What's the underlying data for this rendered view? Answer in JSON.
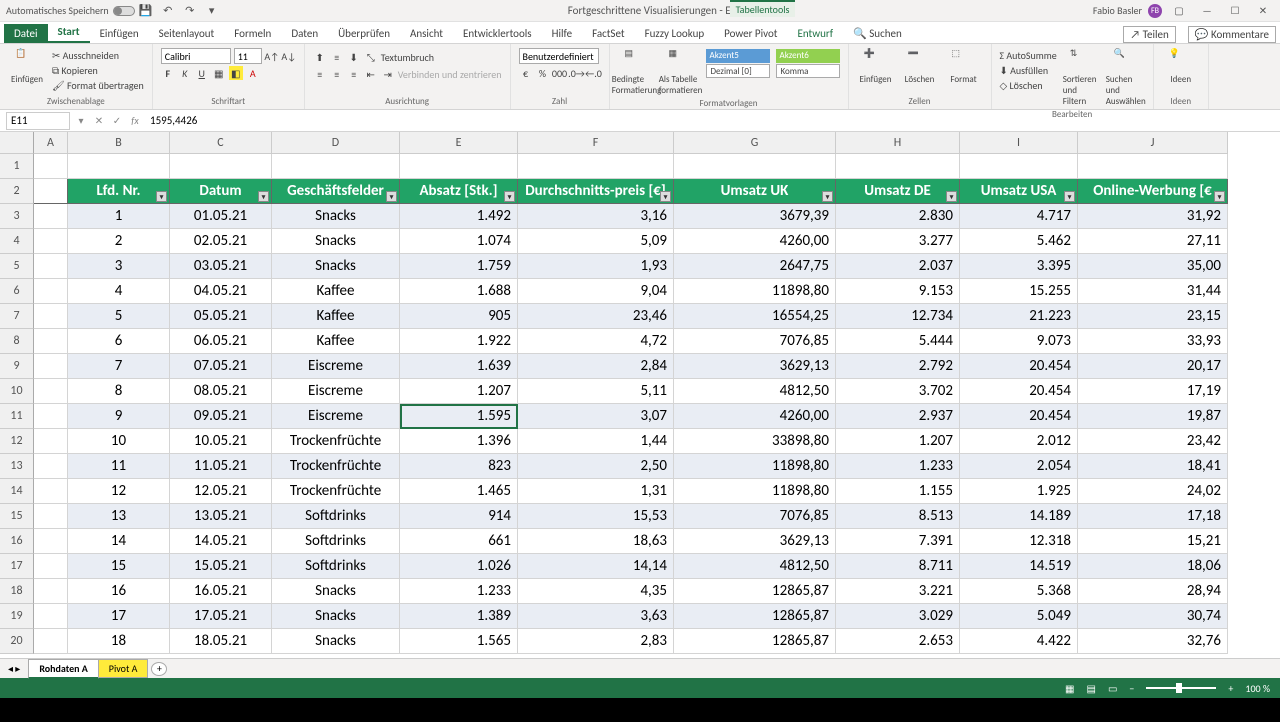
{
  "title": {
    "autosave": "Automatisches Speichern",
    "doc": "Fortgeschrittene Visualisierungen  -  Excel",
    "tabletools": "Tabellentools",
    "user": "Fabio Basler"
  },
  "tabs": {
    "file": "Datei",
    "home": "Start",
    "insert": "Einfügen",
    "layout": "Seitenlayout",
    "formulas": "Formeln",
    "data": "Daten",
    "review": "Überprüfen",
    "view": "Ansicht",
    "dev": "Entwicklertools",
    "help": "Hilfe",
    "factset": "FactSet",
    "fuzzy": "Fuzzy Lookup",
    "pivot": "Power Pivot",
    "design": "Entwurf",
    "search": "Suchen",
    "share": "Teilen",
    "comments": "Kommentare"
  },
  "ribbon": {
    "paste": "Einfügen",
    "cut": "Ausschneiden",
    "copy": "Kopieren",
    "fmtpaint": "Format übertragen",
    "clipboard": "Zwischenablage",
    "font": "Calibri",
    "size": "11",
    "fontgrp": "Schriftart",
    "wrap": "Textumbruch",
    "merge": "Verbinden und zentrieren",
    "align": "Ausrichtung",
    "numfmt": "Benutzerdefiniert",
    "numgrp": "Zahl",
    "condfmt": "Bedingte Formatierung",
    "astable": "Als Tabelle formatieren",
    "ak5": "Akzent5",
    "ak6": "Akzent6",
    "dez": "Dezimal [0]",
    "kom": "Komma",
    "styles": "Formatvorlagen",
    "ins": "Einfügen",
    "del": "Löschen",
    "fmt": "Format",
    "cells": "Zellen",
    "sum": "AutoSumme",
    "fill": "Ausfüllen",
    "clear": "Löschen",
    "sort": "Sortieren und Filtern",
    "find": "Suchen und Auswählen",
    "edit": "Bearbeiten",
    "ideas": "Ideen"
  },
  "fx": {
    "cell": "E11",
    "value": "1595,4426"
  },
  "cols": [
    "A",
    "B",
    "C",
    "D",
    "E",
    "F",
    "G",
    "H",
    "I",
    "J"
  ],
  "headers": [
    "Lfd. Nr.",
    "Datum",
    "Geschäftsfelder",
    "Absatz  [Stk.]",
    "Durchschnitts-preis [€]",
    "Umsatz UK",
    "Umsatz DE",
    "Umsatz USA",
    "Online-Werbung [€"
  ],
  "rows": [
    [
      "1",
      "01.05.21",
      "Snacks",
      "1.492",
      "3,16",
      "3679,39",
      "2.830",
      "4.717",
      "31,92"
    ],
    [
      "2",
      "02.05.21",
      "Snacks",
      "1.074",
      "5,09",
      "4260,00",
      "3.277",
      "5.462",
      "27,11"
    ],
    [
      "3",
      "03.05.21",
      "Snacks",
      "1.759",
      "1,93",
      "2647,75",
      "2.037",
      "3.395",
      "35,00"
    ],
    [
      "4",
      "04.05.21",
      "Kaffee",
      "1.688",
      "9,04",
      "11898,80",
      "9.153",
      "15.255",
      "31,44"
    ],
    [
      "5",
      "05.05.21",
      "Kaffee",
      "905",
      "23,46",
      "16554,25",
      "12.734",
      "21.223",
      "23,15"
    ],
    [
      "6",
      "06.05.21",
      "Kaffee",
      "1.922",
      "4,72",
      "7076,85",
      "5.444",
      "9.073",
      "33,93"
    ],
    [
      "7",
      "07.05.21",
      "Eiscreme",
      "1.639",
      "2,84",
      "3629,13",
      "2.792",
      "20.454",
      "20,17"
    ],
    [
      "8",
      "08.05.21",
      "Eiscreme",
      "1.207",
      "5,11",
      "4812,50",
      "3.702",
      "20.454",
      "17,19"
    ],
    [
      "9",
      "09.05.21",
      "Eiscreme",
      "1.595",
      "3,07",
      "4260,00",
      "2.937",
      "20.454",
      "19,87"
    ],
    [
      "10",
      "10.05.21",
      "Trockenfrüchte",
      "1.396",
      "1,44",
      "33898,80",
      "1.207",
      "2.012",
      "23,42"
    ],
    [
      "11",
      "11.05.21",
      "Trockenfrüchte",
      "823",
      "2,50",
      "11898,80",
      "1.233",
      "2.054",
      "18,41"
    ],
    [
      "12",
      "12.05.21",
      "Trockenfrüchte",
      "1.465",
      "1,31",
      "11898,80",
      "1.155",
      "1.925",
      "24,02"
    ],
    [
      "13",
      "13.05.21",
      "Softdrinks",
      "914",
      "15,53",
      "7076,85",
      "8.513",
      "14.189",
      "17,18"
    ],
    [
      "14",
      "14.05.21",
      "Softdrinks",
      "661",
      "18,63",
      "3629,13",
      "7.391",
      "12.318",
      "15,21"
    ],
    [
      "15",
      "15.05.21",
      "Softdrinks",
      "1.026",
      "14,14",
      "4812,50",
      "8.711",
      "14.519",
      "18,06"
    ],
    [
      "16",
      "16.05.21",
      "Snacks",
      "1.233",
      "4,35",
      "12865,87",
      "3.221",
      "5.368",
      "28,94"
    ],
    [
      "17",
      "17.05.21",
      "Snacks",
      "1.389",
      "3,63",
      "12865,87",
      "3.029",
      "5.049",
      "30,74"
    ],
    [
      "18",
      "18.05.21",
      "Snacks",
      "1.565",
      "2,83",
      "12865,87",
      "2.653",
      "4.422",
      "32,76"
    ]
  ],
  "sheets": {
    "a": "Rohdaten A",
    "b": "Pivot A"
  },
  "status": {
    "zoom": "100 %"
  }
}
